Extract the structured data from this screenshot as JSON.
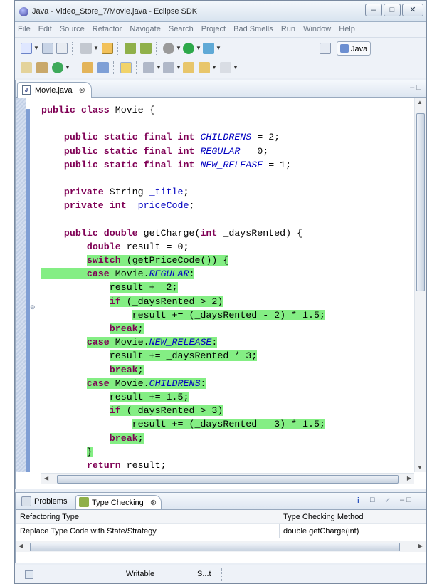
{
  "window": {
    "title": "Java - Video_Store_7/Movie.java - Eclipse SDK",
    "controls": [
      "minimize",
      "maximize",
      "close"
    ]
  },
  "menu": [
    "File",
    "Edit",
    "Source",
    "Refactor",
    "Navigate",
    "Search",
    "Project",
    "Bad Smells",
    "Run",
    "Window",
    "Help"
  ],
  "toolbar": {
    "perspective_label": "Java"
  },
  "editor": {
    "tab_label": "Movie.java",
    "lines": [
      {
        "text": "public class Movie {",
        "hl": false,
        "tokens": [
          {
            "t": "public class",
            "c": "kw"
          },
          {
            "t": " Movie {",
            "c": "tok"
          }
        ]
      },
      {
        "text": "",
        "hl": false,
        "tokens": []
      },
      {
        "text": "    public static final int CHILDRENS = 2;",
        "hl": false,
        "tokens": [
          {
            "t": "    public static final int ",
            "c": "kw"
          },
          {
            "t": "CHILDRENS",
            "c": "const"
          },
          {
            "t": " = 2;",
            "c": "tok"
          }
        ]
      },
      {
        "text": "    public static final int REGULAR = 0;",
        "hl": false,
        "tokens": [
          {
            "t": "    public static final int ",
            "c": "kw"
          },
          {
            "t": "REGULAR",
            "c": "const"
          },
          {
            "t": " = 0;",
            "c": "tok"
          }
        ]
      },
      {
        "text": "    public static final int NEW_RELEASE = 1;",
        "hl": false,
        "tokens": [
          {
            "t": "    public static final int ",
            "c": "kw"
          },
          {
            "t": "NEW_RELEASE",
            "c": "const"
          },
          {
            "t": " = 1;",
            "c": "tok"
          }
        ]
      },
      {
        "text": "",
        "hl": false,
        "tokens": []
      },
      {
        "text": "    private String _title;",
        "hl": false,
        "tokens": [
          {
            "t": "    private",
            "c": "kw"
          },
          {
            "t": " String ",
            "c": "tok"
          },
          {
            "t": "_title",
            "c": "fld"
          },
          {
            "t": ";",
            "c": "tok"
          }
        ]
      },
      {
        "text": "    private int _priceCode;",
        "hl": false,
        "tokens": [
          {
            "t": "    private int",
            "c": "kw"
          },
          {
            "t": " ",
            "c": "tok"
          },
          {
            "t": "_priceCode",
            "c": "fld"
          },
          {
            "t": ";",
            "c": "tok"
          }
        ]
      },
      {
        "text": "",
        "hl": false,
        "tokens": []
      },
      {
        "text": "    public double getCharge(int _daysRented) {",
        "hl": false,
        "tokens": [
          {
            "t": "    public double",
            "c": "kw"
          },
          {
            "t": " getCharge(",
            "c": "tok"
          },
          {
            "t": "int",
            "c": "kw"
          },
          {
            "t": " _daysRented) {",
            "c": "tok"
          }
        ]
      },
      {
        "text": "        double result = 0;",
        "hl": false,
        "tokens": [
          {
            "t": "        double",
            "c": "kw"
          },
          {
            "t": " result = 0;",
            "c": "tok"
          }
        ]
      },
      {
        "text": "        switch (getPriceCode()) {",
        "hl": true,
        "indent": 8,
        "tokens": [
          {
            "t": "switch",
            "c": "kw"
          },
          {
            "t": " (getPriceCode()) {",
            "c": "tok"
          }
        ]
      },
      {
        "text": "        case Movie.REGULAR:",
        "hl": true,
        "indent": 0,
        "tokens": [
          {
            "t": "        case",
            "c": "kw"
          },
          {
            "t": " Movie.",
            "c": "tok"
          },
          {
            "t": "REGULAR",
            "c": "const"
          },
          {
            "t": ":",
            "c": "tok"
          }
        ]
      },
      {
        "text": "            result += 2;",
        "hl": true,
        "indent": 12,
        "tokens": [
          {
            "t": "result += 2;",
            "c": "tok"
          }
        ]
      },
      {
        "text": "            if (_daysRented > 2)",
        "hl": true,
        "indent": 12,
        "tokens": [
          {
            "t": "if",
            "c": "kw"
          },
          {
            "t": " (_daysRented > 2)",
            "c": "tok"
          }
        ]
      },
      {
        "text": "                result += (_daysRented - 2) * 1.5;",
        "hl": true,
        "indent": 16,
        "tokens": [
          {
            "t": "result += (_daysRented - 2) * 1.5;",
            "c": "tok"
          }
        ]
      },
      {
        "text": "            break;",
        "hl": true,
        "indent": 12,
        "tokens": [
          {
            "t": "break",
            "c": "kw"
          },
          {
            "t": ";",
            "c": "tok"
          }
        ]
      },
      {
        "text": "        case Movie.NEW_RELEASE:",
        "hl": true,
        "indent": 8,
        "tokens": [
          {
            "t": "case",
            "c": "kw"
          },
          {
            "t": " Movie.",
            "c": "tok"
          },
          {
            "t": "NEW_RELEASE",
            "c": "const"
          },
          {
            "t": ":",
            "c": "tok"
          }
        ]
      },
      {
        "text": "            result += _daysRented * 3;",
        "hl": true,
        "indent": 12,
        "tokens": [
          {
            "t": "result += _daysRented * 3;",
            "c": "tok"
          }
        ]
      },
      {
        "text": "            break;",
        "hl": true,
        "indent": 12,
        "tokens": [
          {
            "t": "break",
            "c": "kw"
          },
          {
            "t": ";",
            "c": "tok"
          }
        ]
      },
      {
        "text": "        case Movie.CHILDRENS:",
        "hl": true,
        "indent": 8,
        "tokens": [
          {
            "t": "case",
            "c": "kw"
          },
          {
            "t": " Movie.",
            "c": "tok"
          },
          {
            "t": "CHILDRENS",
            "c": "const"
          },
          {
            "t": ":",
            "c": "tok"
          }
        ]
      },
      {
        "text": "            result += 1.5;",
        "hl": true,
        "indent": 12,
        "tokens": [
          {
            "t": "result += 1.5;",
            "c": "tok"
          }
        ]
      },
      {
        "text": "            if (_daysRented > 3)",
        "hl": true,
        "indent": 12,
        "tokens": [
          {
            "t": "if",
            "c": "kw"
          },
          {
            "t": " (_daysRented > 3)",
            "c": "tok"
          }
        ]
      },
      {
        "text": "                result += (_daysRented - 3) * 1.5;",
        "hl": true,
        "indent": 16,
        "tokens": [
          {
            "t": "result += (_daysRented - 3) * 1.5;",
            "c": "tok"
          }
        ]
      },
      {
        "text": "            break;",
        "hl": true,
        "indent": 12,
        "tokens": [
          {
            "t": "break",
            "c": "kw"
          },
          {
            "t": ";",
            "c": "tok"
          }
        ]
      },
      {
        "text": "        }",
        "hl": true,
        "indent": 8,
        "tokens": [
          {
            "t": "}",
            "c": "tok"
          }
        ]
      },
      {
        "text": "        return result;",
        "hl": false,
        "tokens": [
          {
            "t": "        return",
            "c": "kw"
          },
          {
            "t": " result;",
            "c": "tok"
          }
        ]
      },
      {
        "text": "    }",
        "hl": false,
        "tokens": [
          {
            "t": "    }",
            "c": "tok"
          }
        ]
      }
    ]
  },
  "bottom_panel": {
    "tabs": [
      "Problems",
      "Type Checking"
    ],
    "columns": [
      "Refactoring Type",
      "Type Checking Method"
    ],
    "rows": [
      [
        "Replace Type Code with State/Strategy",
        "double getCharge(int)"
      ]
    ]
  },
  "statusbar": {
    "mode": "Writable",
    "insert": "S...t"
  },
  "colors": {
    "highlight": "#84ee84",
    "keyword": "#7f0055",
    "constant": "#0000c0"
  }
}
